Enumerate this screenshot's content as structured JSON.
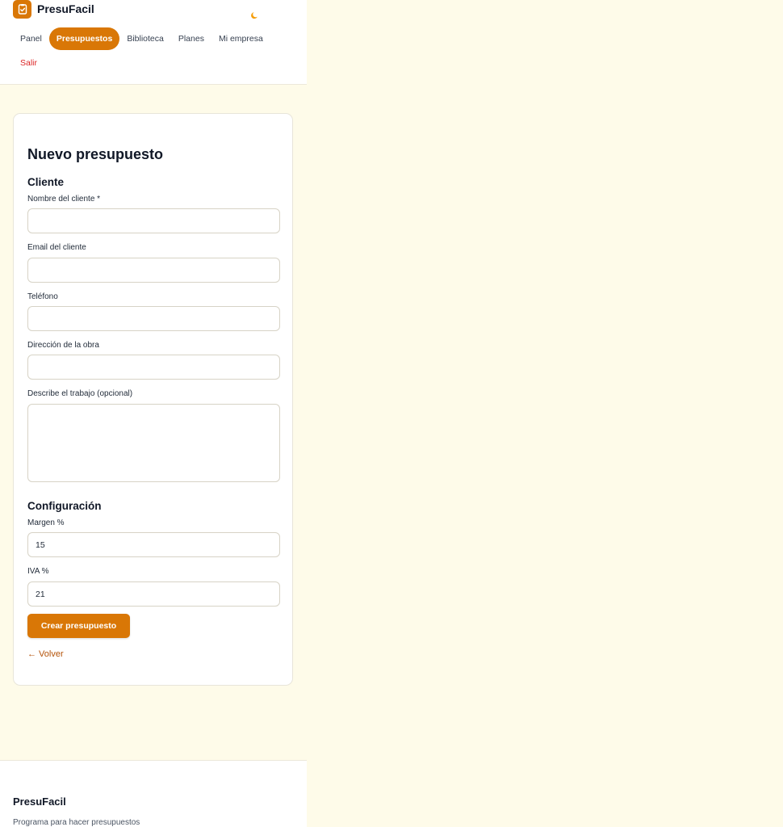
{
  "header": {
    "brand_name": "PresuFacil",
    "nav": [
      {
        "label": "Panel"
      },
      {
        "label": "Presupuestos"
      },
      {
        "label": "Biblioteca"
      },
      {
        "label": "Planes"
      },
      {
        "label": "Mi empresa"
      },
      {
        "label": "Salir"
      }
    ],
    "logo_icon": "clipboard-check-icon",
    "theme_icon": "moon-icon"
  },
  "form": {
    "title": "Nuevo presupuesto",
    "client_section": "Cliente",
    "client_name_label": "Nombre del cliente *",
    "client_name_value": "",
    "client_email_label": "Email del cliente",
    "client_email_value": "",
    "phone_label": "Teléfono",
    "phone_value": "",
    "address_label": "Dirección de la obra",
    "address_value": "",
    "description_label": "Describe el trabajo (opcional)",
    "description_value": "",
    "config_section": "Configuración",
    "margin_label": "Margen %",
    "margin_value": "15",
    "vat_label": "IVA %",
    "vat_value": "21",
    "submit_label": "Crear presupuesto",
    "back_label": "← Volver"
  },
  "footer": {
    "brand_name": "PresuFacil",
    "tagline": "Programa para hacer presupuestos"
  },
  "colors": {
    "accent": "#d97706",
    "background": "#fefbe9",
    "danger": "#dc2626",
    "link": "#b45309"
  }
}
